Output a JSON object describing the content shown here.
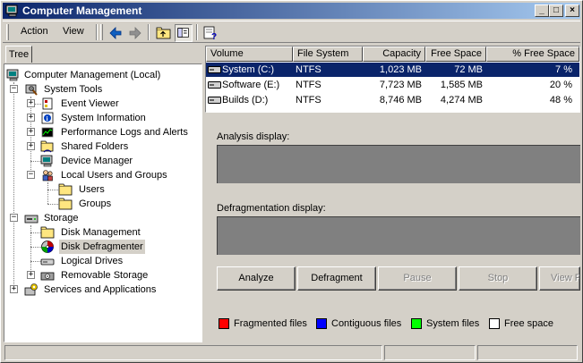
{
  "window": {
    "title": "Computer Management",
    "controls": {
      "minimize": "_",
      "maximize": "□",
      "close": "×"
    }
  },
  "menu": {
    "action": "Action",
    "view": "View"
  },
  "toolbar": {
    "icons": [
      "back-arrow-icon",
      "forward-arrow-icon",
      "up-folder-icon",
      "show-hide-tree-icon",
      "properties-help-icon"
    ]
  },
  "tree": {
    "tab_label": "Tree",
    "root": "Computer Management (Local)",
    "system_tools": "System Tools",
    "event_viewer": "Event Viewer",
    "system_information": "System Information",
    "performance_logs": "Performance Logs and Alerts",
    "shared_folders": "Shared Folders",
    "device_manager": "Device Manager",
    "local_users_groups": "Local Users and Groups",
    "users": "Users",
    "groups": "Groups",
    "storage": "Storage",
    "disk_management": "Disk Management",
    "disk_defragmenter": "Disk Defragmenter",
    "logical_drives": "Logical Drives",
    "removable_storage": "Removable Storage",
    "services_applications": "Services and Applications"
  },
  "volumes": {
    "columns": [
      "Volume",
      "File System",
      "Capacity",
      "Free Space",
      "% Free Space"
    ],
    "rows": [
      {
        "volume": "System (C:)",
        "fs": "NTFS",
        "capacity": "1,023 MB",
        "free": "72 MB",
        "pct": "7 %"
      },
      {
        "volume": "Software (E:)",
        "fs": "NTFS",
        "capacity": "7,723 MB",
        "free": "1,585 MB",
        "pct": "20 %"
      },
      {
        "volume": "Builds (D:)",
        "fs": "NTFS",
        "capacity": "8,746 MB",
        "free": "4,274 MB",
        "pct": "48 %"
      }
    ]
  },
  "defrag": {
    "analysis_label": "Analysis display:",
    "defrag_label": "Defragmentation display:",
    "buttons": {
      "analyze": "Analyze",
      "defragment": "Defragment",
      "pause": "Pause",
      "stop": "Stop",
      "view_report": "View R"
    },
    "legend": [
      {
        "label": "Fragmented files",
        "color": "#ff0000"
      },
      {
        "label": "Contiguous files",
        "color": "#0000ff"
      },
      {
        "label": "System files",
        "color": "#00ff00"
      },
      {
        "label": "Free space",
        "color": "#ffffff"
      }
    ]
  }
}
